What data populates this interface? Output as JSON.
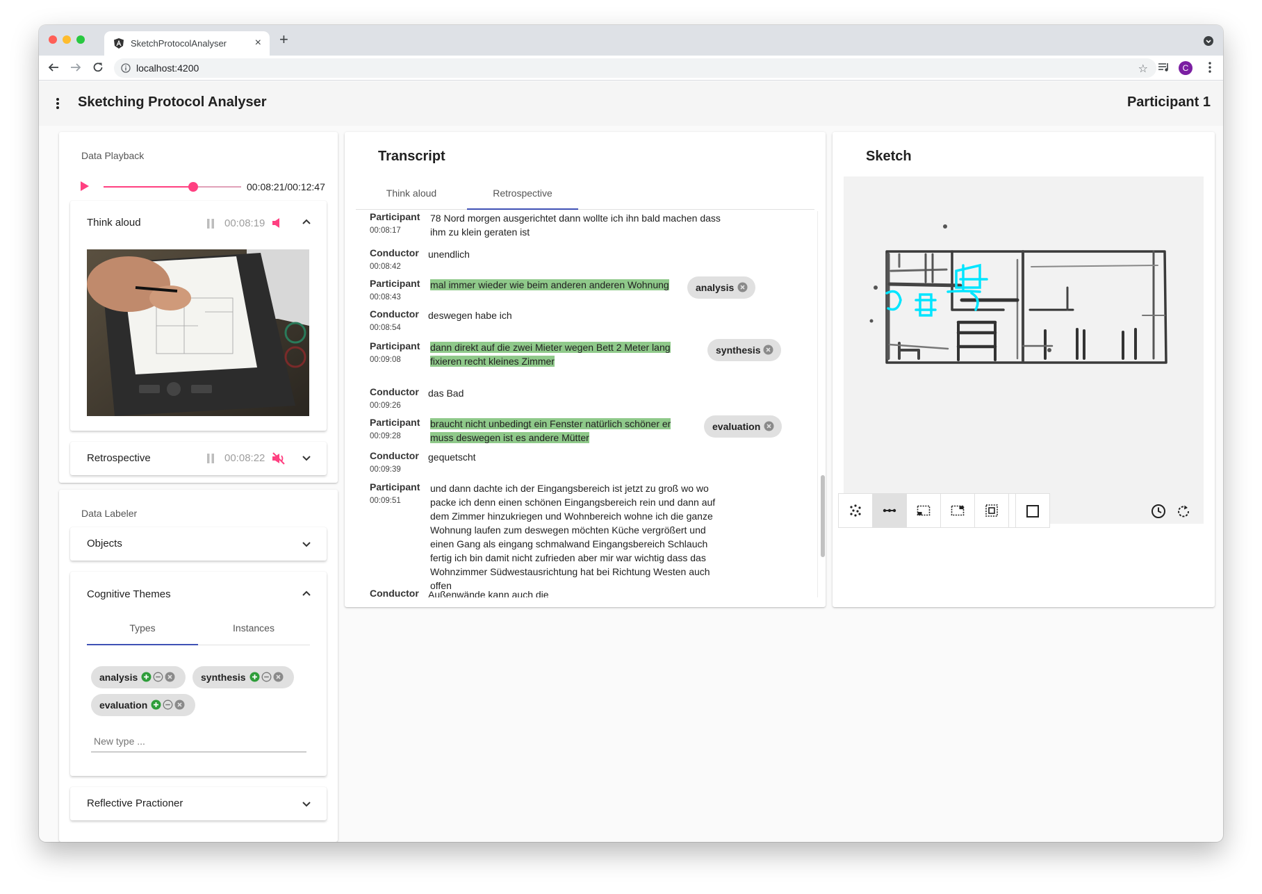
{
  "browser": {
    "tab_title": "SketchProtocolAnalyser",
    "tab_close": "×",
    "new_tab": "+",
    "url": "localhost:4200",
    "avatar_letter": "C"
  },
  "app": {
    "title": "Sketching Protocol Analyser",
    "participant": "Participant 1"
  },
  "playback": {
    "label": "Data Playback",
    "time": "00:08:21/00:12:47",
    "progress": 0.65,
    "streams": [
      {
        "title": "Think aloud",
        "time": "00:08:19",
        "expanded": true,
        "muted": false
      },
      {
        "title": "Retrospective",
        "time": "00:08:22",
        "expanded": false,
        "muted": true
      }
    ]
  },
  "labeler": {
    "label": "Data Labeler",
    "objects": "Objects",
    "cognitive_themes": {
      "title": "Cognitive Themes",
      "tabs": [
        "Types",
        "Instances"
      ],
      "active_tab": "Types",
      "chips": [
        "analysis",
        "synthesis",
        "evaluation"
      ],
      "new_type_placeholder": "New type ..."
    },
    "reflective": "Reflective Practioner"
  },
  "transcript": {
    "title": "Transcript",
    "tabs": [
      "Think aloud",
      "Retrospective"
    ],
    "active_tab": "Retrospective",
    "entries": [
      {
        "speaker": "Participant",
        "time": "00:08:17",
        "text": "78 Nord morgen ausgerichtet dann wollte ich ihn bald machen dass ihm zu klein geraten ist",
        "highlighted": false,
        "tag": null
      },
      {
        "speaker": "Conductor",
        "time": "00:08:42",
        "text": "unendlich",
        "highlighted": false,
        "tag": null
      },
      {
        "speaker": "Participant",
        "time": "00:08:43",
        "text": "mal immer wieder wie beim anderen anderen Wohnung",
        "highlighted": true,
        "tag": "analysis"
      },
      {
        "speaker": "Conductor",
        "time": "00:08:54",
        "text": "deswegen habe ich",
        "highlighted": false,
        "tag": null
      },
      {
        "speaker": "Participant",
        "time": "00:09:08",
        "text": "dann direkt auf die zwei Mieter wegen Bett 2 Meter lang fixieren recht kleines Zimmer",
        "highlighted": true,
        "tag": "synthesis"
      },
      {
        "speaker": "Conductor",
        "time": "00:09:26",
        "text": "das Bad",
        "highlighted": false,
        "tag": null
      },
      {
        "speaker": "Participant",
        "time": "00:09:28",
        "text": "braucht nicht unbedingt ein Fenster natürlich schöner er muss deswegen ist es andere Mütter",
        "highlighted": true,
        "tag": "evaluation"
      },
      {
        "speaker": "Conductor",
        "time": "00:09:39",
        "text": "gequetscht",
        "highlighted": false,
        "tag": null
      },
      {
        "speaker": "Participant",
        "time": "00:09:51",
        "text": "und dann dachte ich der Eingangsbereich ist jetzt zu groß wo wo packe ich denn einen schönen Eingangsbereich rein und dann auf dem Zimmer hinzukriegen und Wohnbereich wohne ich die ganze Wohnung laufen zum deswegen möchten Küche vergrößert und einen Gang als eingang schmalwand Eingangsbereich Schlauch fertig ich bin damit nicht zufrieden aber mir war wichtig dass das Wohnzimmer Südwestausrichtung hat bei Richtung Westen auch offen",
        "highlighted": false,
        "tag": null
      },
      {
        "speaker": "Conductor",
        "time": "",
        "text": "Außenwände kann auch die",
        "highlighted": false,
        "tag": null
      }
    ]
  },
  "sketch": {
    "title": "Sketch",
    "tools": [
      "scatter-tool",
      "line-tool",
      "region-tool",
      "region-alt-tool",
      "select-tool",
      "box-tool"
    ],
    "active_tool": 1
  },
  "colors": {
    "accent": "#ff4081",
    "primary": "#3f51b5",
    "highlight": "#8fc98a",
    "add_green": "#2e9d3a",
    "sketch_cyan": "#00e5ff"
  }
}
